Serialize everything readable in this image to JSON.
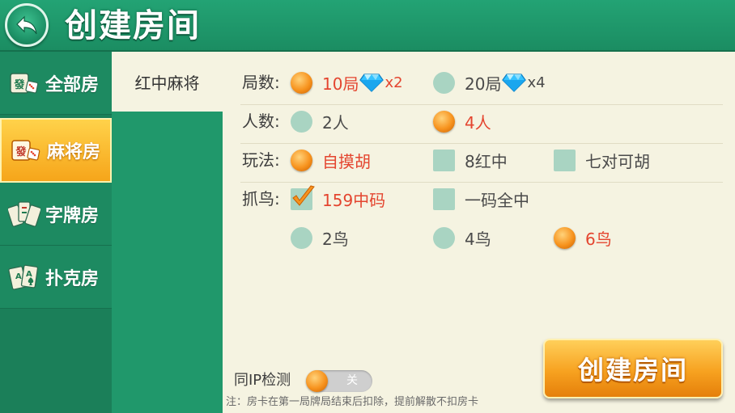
{
  "header": {
    "title": "创建房间"
  },
  "sidebar": {
    "items": [
      {
        "label": "全部房",
        "icon": "mahjong-tile-dice-icon",
        "active": false
      },
      {
        "label": "麻将房",
        "icon": "mahjong-tile-dice-icon",
        "active": true
      },
      {
        "label": "字牌房",
        "icon": "word-cards-icon",
        "active": false
      },
      {
        "label": "扑克房",
        "icon": "poker-cards-icon",
        "active": false
      }
    ]
  },
  "game": {
    "selected": "红中麻将"
  },
  "options": {
    "rounds": {
      "label": "局数:",
      "choices": [
        {
          "text": "10局",
          "mult": "x2",
          "selected": true
        },
        {
          "text": "20局",
          "mult": "x4",
          "selected": false
        }
      ]
    },
    "players": {
      "label": "人数:",
      "choices": [
        {
          "text": "2人",
          "selected": false
        },
        {
          "text": "4人",
          "selected": true
        }
      ]
    },
    "play": {
      "label": "玩法:",
      "choices": [
        {
          "text": "自摸胡",
          "selected": true,
          "kind": "radio"
        },
        {
          "text": "8红中",
          "selected": false,
          "kind": "checkbox"
        },
        {
          "text": "七对可胡",
          "selected": false,
          "kind": "checkbox"
        }
      ]
    },
    "birds": {
      "label": "抓鸟:",
      "choices": [
        {
          "text": "159中码",
          "selected": true,
          "kind": "checkbox"
        },
        {
          "text": "一码全中",
          "selected": false,
          "kind": "checkbox"
        },
        {
          "text": "2鸟",
          "selected": false,
          "kind": "radio"
        },
        {
          "text": "4鸟",
          "selected": false,
          "kind": "radio"
        },
        {
          "text": "6鸟",
          "selected": true,
          "kind": "radio"
        }
      ]
    }
  },
  "footer": {
    "ip_label": "同IP检测",
    "ip_toggle": "关",
    "note": "注：房卡在第一局牌局结束后扣除，提前解散不扣房卡",
    "create_label": "创建房间"
  },
  "colors": {
    "primary_green": "#1f8a63",
    "panel_bg": "#f5f3e1",
    "accent_orange": "#f7a220",
    "selected_text": "#e4452f",
    "unselected_control": "#a9d4c2"
  }
}
